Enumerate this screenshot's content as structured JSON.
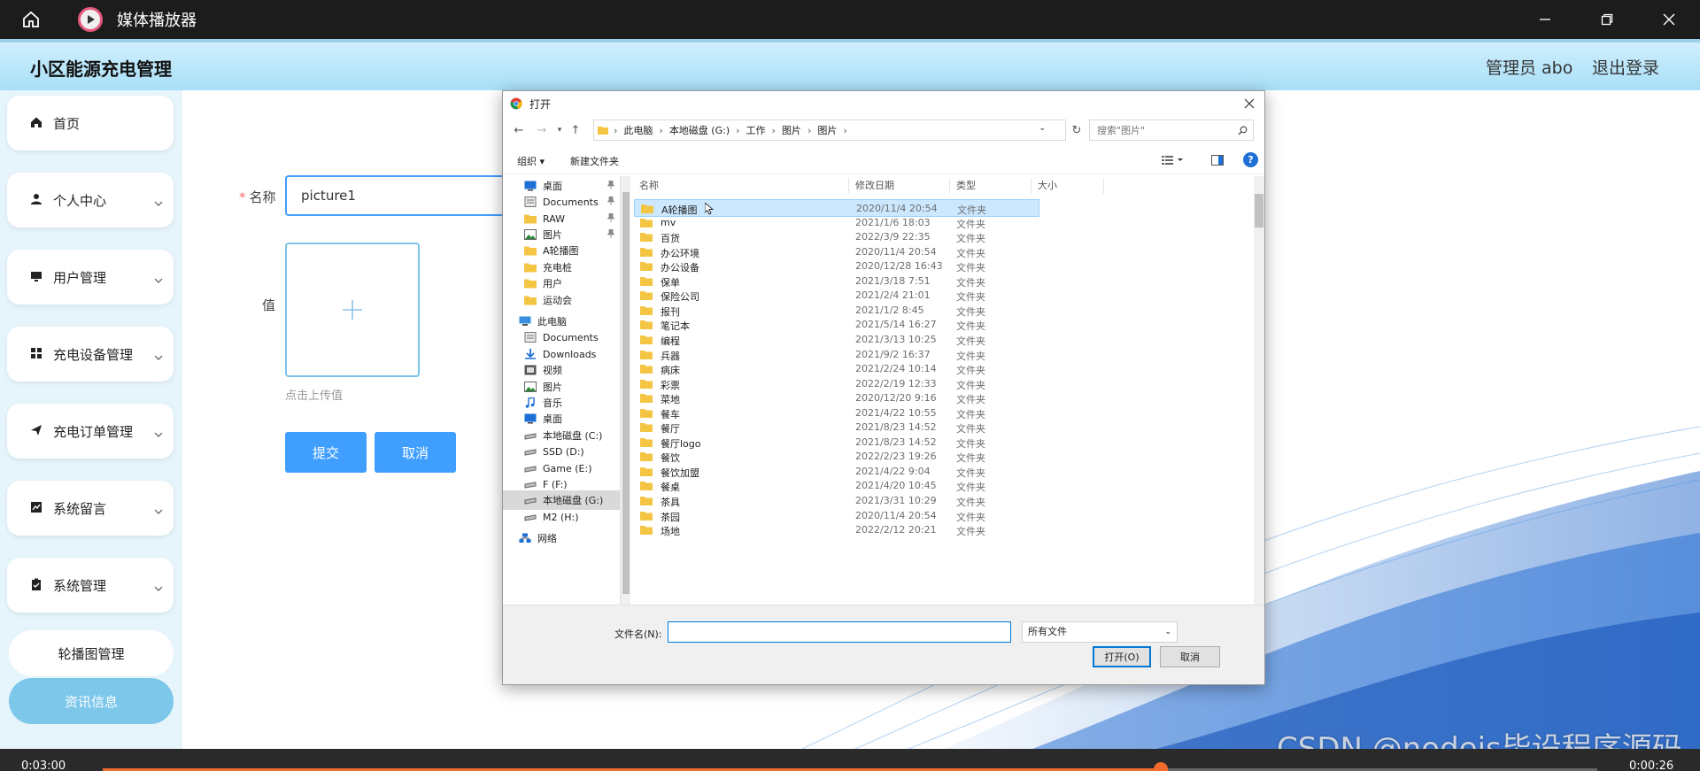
{
  "player": {
    "title": "媒体播放器",
    "time_elapsed": "0:03:00",
    "time_total": "0:00:26",
    "progress_fraction": 0.708
  },
  "site": {
    "title": "小区能源充电管理",
    "admin": "管理员 abo",
    "logout": "退出登录"
  },
  "sidebar": {
    "items": [
      {
        "label": "首页",
        "icon": "home-icon"
      },
      {
        "label": "个人中心",
        "icon": "user-icon"
      },
      {
        "label": "用户管理",
        "icon": "monitor-icon"
      },
      {
        "label": "充电设备管理",
        "icon": "grid-icon"
      },
      {
        "label": "充电订单管理",
        "icon": "send-icon"
      },
      {
        "label": "系统留言",
        "icon": "chart-icon"
      },
      {
        "label": "系统管理",
        "icon": "clipboard-icon"
      }
    ],
    "sub_items": [
      {
        "label": "轮播图管理"
      },
      {
        "label": "资讯信息"
      }
    ]
  },
  "form": {
    "name_label": "名称",
    "name_value": "picture1",
    "value_label": "值",
    "upload_hint": "点击上传值",
    "submit": "提交",
    "cancel": "取消"
  },
  "dialog": {
    "title": "打开",
    "breadcrumb": [
      "此电脑",
      "本地磁盘 (G:)",
      "工作",
      "图片",
      "图片"
    ],
    "search_placeholder": "搜索\"图片\"",
    "organize": "组织 ▾",
    "new_folder": "新建文件夹",
    "columns": {
      "name": "名称",
      "modified": "修改日期",
      "type": "类型",
      "size": "大小"
    },
    "nav": [
      {
        "label": "桌面",
        "pinned": true,
        "kind": "desktop"
      },
      {
        "label": "Documents",
        "pinned": true,
        "kind": "docs"
      },
      {
        "label": "RAW",
        "pinned": true,
        "kind": "folder"
      },
      {
        "label": "图片",
        "pinned": true,
        "kind": "pics"
      },
      {
        "label": "A轮播图",
        "pinned": false,
        "kind": "folder"
      },
      {
        "label": "充电桩",
        "pinned": false,
        "kind": "folder"
      },
      {
        "label": "用户",
        "pinned": false,
        "kind": "folder"
      },
      {
        "label": "运动会",
        "pinned": false,
        "kind": "folder"
      },
      {
        "label": "此电脑",
        "pinned": false,
        "kind": "pc"
      },
      {
        "label": "Documents",
        "pinned": false,
        "kind": "docs"
      },
      {
        "label": "Downloads",
        "pinned": false,
        "kind": "download"
      },
      {
        "label": "视频",
        "pinned": false,
        "kind": "video"
      },
      {
        "label": "图片",
        "pinned": false,
        "kind": "pics"
      },
      {
        "label": "音乐",
        "pinned": false,
        "kind": "music"
      },
      {
        "label": "桌面",
        "pinned": false,
        "kind": "desktop"
      },
      {
        "label": "本地磁盘 (C:)",
        "pinned": false,
        "kind": "drive"
      },
      {
        "label": "SSD (D:)",
        "pinned": false,
        "kind": "drive"
      },
      {
        "label": "Game (E:)",
        "pinned": false,
        "kind": "drive"
      },
      {
        "label": "F (F:)",
        "pinned": false,
        "kind": "drive"
      },
      {
        "label": "本地磁盘 (G:)",
        "pinned": false,
        "kind": "drive",
        "selected": true
      },
      {
        "label": "M2 (H:)",
        "pinned": false,
        "kind": "drive"
      },
      {
        "label": "网络",
        "pinned": false,
        "kind": "network"
      }
    ],
    "files": [
      {
        "name": "A轮播图",
        "date": "2020/11/4 20:54",
        "type": "文件夹",
        "selected": true
      },
      {
        "name": "mv",
        "date": "2021/1/6 18:03",
        "type": "文件夹"
      },
      {
        "name": "百货",
        "date": "2022/3/9 22:35",
        "type": "文件夹"
      },
      {
        "name": "办公环境",
        "date": "2020/11/4 20:54",
        "type": "文件夹"
      },
      {
        "name": "办公设备",
        "date": "2020/12/28 16:43",
        "type": "文件夹"
      },
      {
        "name": "保单",
        "date": "2021/3/18 7:51",
        "type": "文件夹"
      },
      {
        "name": "保险公司",
        "date": "2021/2/4 21:01",
        "type": "文件夹"
      },
      {
        "name": "报刊",
        "date": "2021/1/2 8:45",
        "type": "文件夹"
      },
      {
        "name": "笔记本",
        "date": "2021/5/14 16:27",
        "type": "文件夹"
      },
      {
        "name": "编程",
        "date": "2021/3/13 10:25",
        "type": "文件夹"
      },
      {
        "name": "兵器",
        "date": "2021/9/2 16:37",
        "type": "文件夹"
      },
      {
        "name": "病床",
        "date": "2021/2/24 10:14",
        "type": "文件夹"
      },
      {
        "name": "彩票",
        "date": "2022/2/19 12:33",
        "type": "文件夹"
      },
      {
        "name": "菜地",
        "date": "2020/12/20 9:16",
        "type": "文件夹"
      },
      {
        "name": "餐车",
        "date": "2021/4/22 10:55",
        "type": "文件夹"
      },
      {
        "name": "餐厅",
        "date": "2021/8/23 14:52",
        "type": "文件夹"
      },
      {
        "name": "餐厅logo",
        "date": "2021/8/23 14:52",
        "type": "文件夹"
      },
      {
        "name": "餐饮",
        "date": "2022/2/23 19:26",
        "type": "文件夹"
      },
      {
        "name": "餐饮加盟",
        "date": "2021/4/22 9:04",
        "type": "文件夹"
      },
      {
        "name": "餐桌",
        "date": "2021/4/20 10:45",
        "type": "文件夹"
      },
      {
        "name": "茶具",
        "date": "2021/3/31 10:29",
        "type": "文件夹"
      },
      {
        "name": "茶园",
        "date": "2020/11/4 20:54",
        "type": "文件夹"
      },
      {
        "name": "场地",
        "date": "2022/2/12 20:21",
        "type": "文件夹"
      }
    ],
    "filename_label": "文件名(N):",
    "filename_value": "",
    "filetype_value": "所有文件",
    "open_button": "打开(O)",
    "cancel_button": "取消"
  },
  "watermark": "CSDN @nodejs毕设程序源码",
  "colors": {
    "header_gradient_top": "#cfeffd",
    "accent_blue": "#409eff",
    "sidebar_active": "#7cc7ea",
    "progress": "#f26b2d",
    "folder": "#f4c542"
  }
}
